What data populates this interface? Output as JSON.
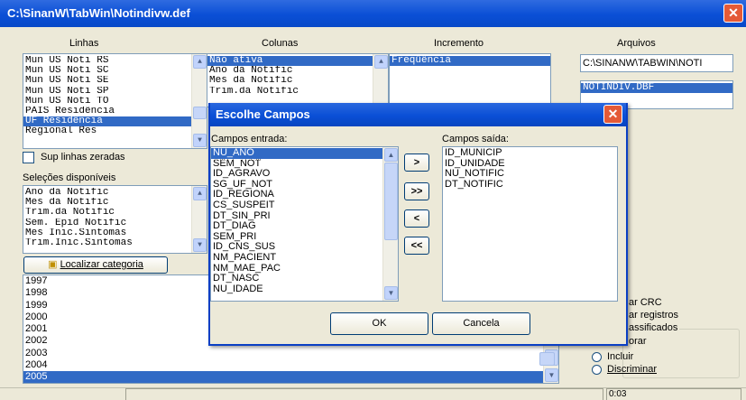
{
  "window": {
    "title": "C:\\SinanW\\TabWin\\Notindivw.def"
  },
  "labels": {
    "linhas": "Linhas",
    "colunas": "Colunas",
    "incremento": "Incremento",
    "arquivos": "Arquivos",
    "selecoes": "Seleções disponíveis"
  },
  "linhas": {
    "items": [
      "Mun US Noti RS",
      "Mun US Noti SC",
      "Mun US Noti SE",
      "Mun US Noti SP",
      "Mun US Noti TO",
      "PAIS Residência",
      "UF Residência",
      "Regional Res"
    ],
    "selected": 6
  },
  "colunas": {
    "items": [
      "Não ativa",
      "Ano da Notific",
      "Mes da Notific",
      "Trim.da Notific"
    ],
    "selected": 0
  },
  "incremento": {
    "items": [
      "Freqüência"
    ],
    "selected": 0
  },
  "arquivos": {
    "path": "C:\\SINANW\\TABWIN\\NOTI",
    "files": [
      "NOTINDIV.DBF"
    ]
  },
  "sup_linhas": {
    "label": "Sup linhas zeradas"
  },
  "selecoes": {
    "items": [
      "Ano da Notific",
      "Mes da Notific",
      "Trim.da Notific",
      "Sem. Epid Notific",
      "Mes Inic.Sintomas",
      "Trim.Inic.Sintomas"
    ]
  },
  "localizar": {
    "label": "Localizar categoria"
  },
  "years": {
    "items": [
      "1997",
      "1998",
      "1999",
      "2000",
      "2001",
      "2002",
      "2003",
      "2004",
      "2005"
    ],
    "selected": 8
  },
  "options": {
    "crc": "ar CRC",
    "registros": "ar registros",
    "classificados": "assificados",
    "ignorar": "orar",
    "incluir": "Incluir",
    "discriminar": "Discriminar"
  },
  "status": {
    "time": "0:03"
  },
  "dialog": {
    "title": "Escolhe Campos",
    "entrada_label": "Campos entrada:",
    "saida_label": "Campos saída:",
    "entrada": [
      "NU_ANO",
      "SEM_NOT",
      "ID_AGRAVO",
      "SG_UF_NOT",
      "ID_REGIONA",
      "CS_SUSPEIT",
      "DT_SIN_PRI",
      "DT_DIAG",
      "SEM_PRI",
      "ID_CNS_SUS",
      "NM_PACIENT",
      "NM_MAE_PAC",
      "DT_NASC",
      "NU_IDADE"
    ],
    "entrada_selected": 0,
    "saida": [
      "ID_MUNICIP",
      "ID_UNIDADE",
      "NU_NOTIFIC",
      "DT_NOTIFIC"
    ],
    "move_one": ">",
    "move_all": ">>",
    "back_one": "<",
    "back_all": "<<",
    "ok": "OK",
    "cancel": "Cancela"
  },
  "colors": {
    "title_blue": "#0a4fd6",
    "selection": "#316ac5",
    "close_red": "#e45a37"
  }
}
